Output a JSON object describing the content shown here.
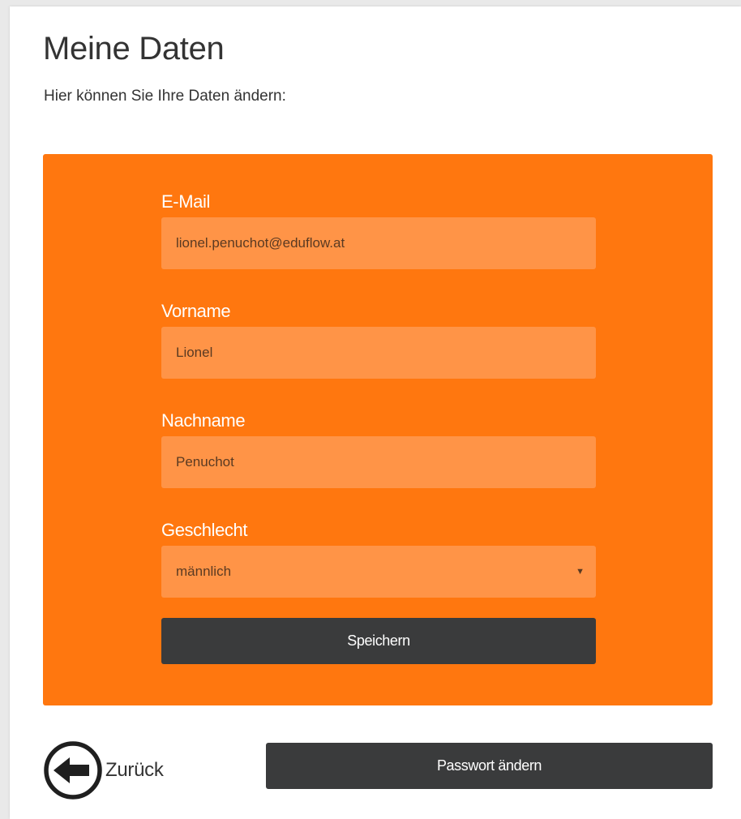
{
  "page": {
    "title": "Meine Daten",
    "subtitle": "Hier können Sie Ihre Daten ändern:"
  },
  "form": {
    "email": {
      "label": "E-Mail",
      "value": "lionel.penuchot@eduflow.at"
    },
    "firstname": {
      "label": "Vorname",
      "value": "Lionel"
    },
    "lastname": {
      "label": "Nachname",
      "value": "Penuchot"
    },
    "gender": {
      "label": "Geschlecht",
      "selected": "männlich"
    },
    "save_label": "Speichern"
  },
  "footer": {
    "back_label": "Zurück",
    "back_icon": "arrow-left-circle-icon",
    "password_label": "Passwort ändern"
  },
  "colors": {
    "panel": "#ff770f",
    "field": "#ff9447",
    "button": "#3a3b3c",
    "text": "#333333"
  }
}
